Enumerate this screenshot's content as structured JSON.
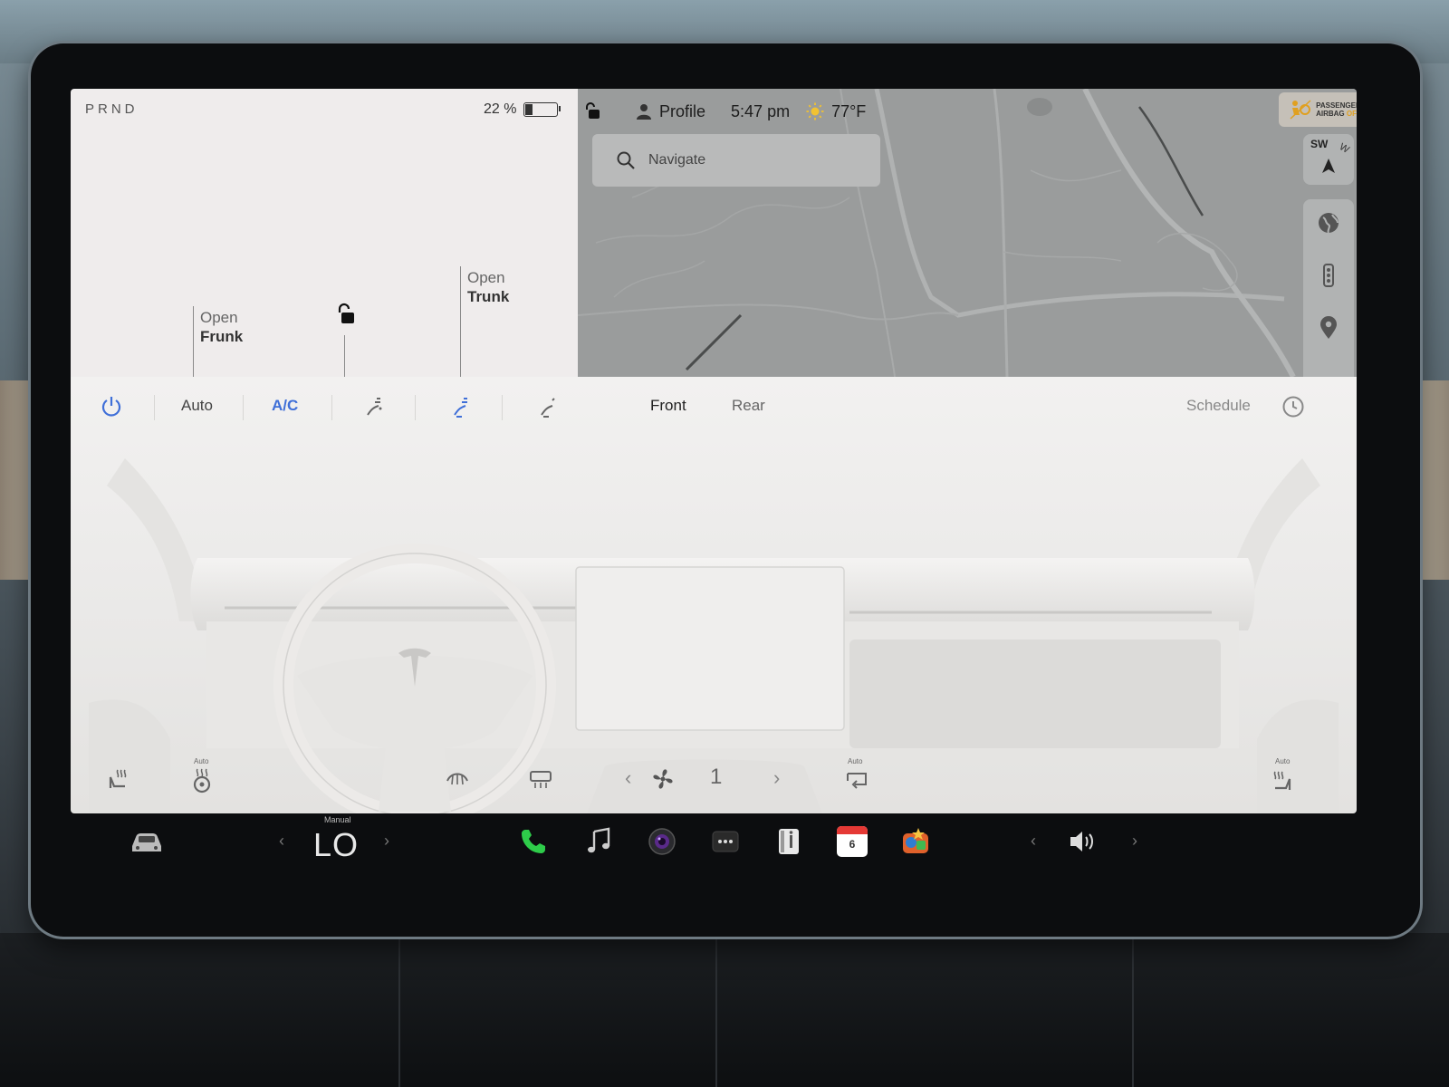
{
  "car": {
    "gear": "PRND",
    "battery_percent_label": "22 %",
    "battery_level": 0.22,
    "frunk": {
      "line1": "Open",
      "line2": "Frunk"
    },
    "trunk": {
      "line1": "Open",
      "line2": "Trunk"
    }
  },
  "status_bar": {
    "profile": "Profile",
    "time": "5:47 pm",
    "temperature": "77°F"
  },
  "map": {
    "search_placeholder": "Navigate",
    "compass_primary": "SW",
    "compass_secondary": "W",
    "airbag": {
      "line1": "PASSENGER",
      "line2": "AIRBAG",
      "state": "OFF"
    }
  },
  "climate": {
    "auto_label": "Auto",
    "ac_label": "A/C",
    "front_label": "Front",
    "rear_label": "Rear",
    "schedule_label": "Schedule",
    "fan_speed": "1",
    "auto_tags": [
      "Auto",
      "Auto",
      "Auto"
    ]
  },
  "dock": {
    "temperature_mode": "Manual",
    "temperature_value": "LO",
    "calendar_day": "6"
  },
  "colors": {
    "accent_blue": "#3f6fd8",
    "phone_green": "#2ecc4a",
    "calendar_red": "#e53935"
  }
}
